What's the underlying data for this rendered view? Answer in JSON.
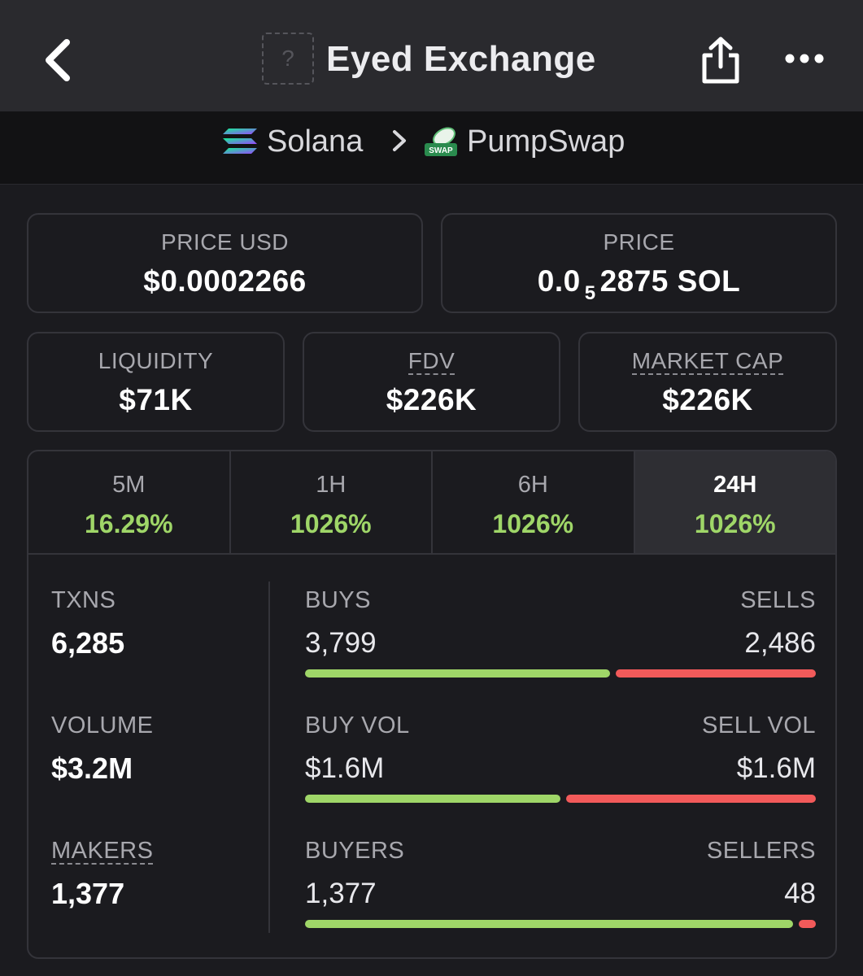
{
  "header": {
    "title": "Eyed Exchange",
    "token_icon_placeholder": "?",
    "back_icon": "chevron-left-icon",
    "share_icon": "share-icon",
    "more_icon": "more-horizontal-icon"
  },
  "breadcrumb": {
    "chain": "Solana",
    "dex": "PumpSwap",
    "dex_logo_text": "SWAP"
  },
  "price_cards": {
    "price_usd": {
      "label": "PRICE USD",
      "value": "$0.0002266"
    },
    "price_native": {
      "label": "PRICE",
      "value_prefix": "0.0",
      "value_subscript": "5",
      "value_suffix": "2875 SOL"
    }
  },
  "metric_cards": {
    "liquidity": {
      "label": "LIQUIDITY",
      "value": "$71K"
    },
    "fdv": {
      "label": "FDV",
      "value": "$226K"
    },
    "market_cap": {
      "label": "MARKET CAP",
      "value": "$226K"
    }
  },
  "timeframes": [
    {
      "label": "5M",
      "change": "16.29%"
    },
    {
      "label": "1H",
      "change": "1026%"
    },
    {
      "label": "6H",
      "change": "1026%"
    },
    {
      "label": "24H",
      "change": "1026%",
      "selected": true
    }
  ],
  "stats": {
    "txns": {
      "label": "TXNS",
      "value": "6,285"
    },
    "volume": {
      "label": "VOLUME",
      "value": "$3.2M"
    },
    "makers": {
      "label": "MAKERS",
      "value": "1,377"
    }
  },
  "breakdown": {
    "txns": {
      "left_label": "BUYS",
      "right_label": "SELLS",
      "left_value": "3,799",
      "right_value": "2,486",
      "buy_fraction": 0.604
    },
    "volume": {
      "left_label": "BUY VOL",
      "right_label": "SELL VOL",
      "left_value": "$1.6M",
      "right_value": "$1.6M",
      "buy_fraction": 0.505
    },
    "makers": {
      "left_label": "BUYERS",
      "right_label": "SELLERS",
      "left_value": "1,377",
      "right_value": "48",
      "buy_fraction": 0.966
    }
  },
  "colors": {
    "positive": "#9fd668",
    "negative": "#f25a5a",
    "background": "#1b1b1f",
    "header": "#2a2a2e"
  }
}
